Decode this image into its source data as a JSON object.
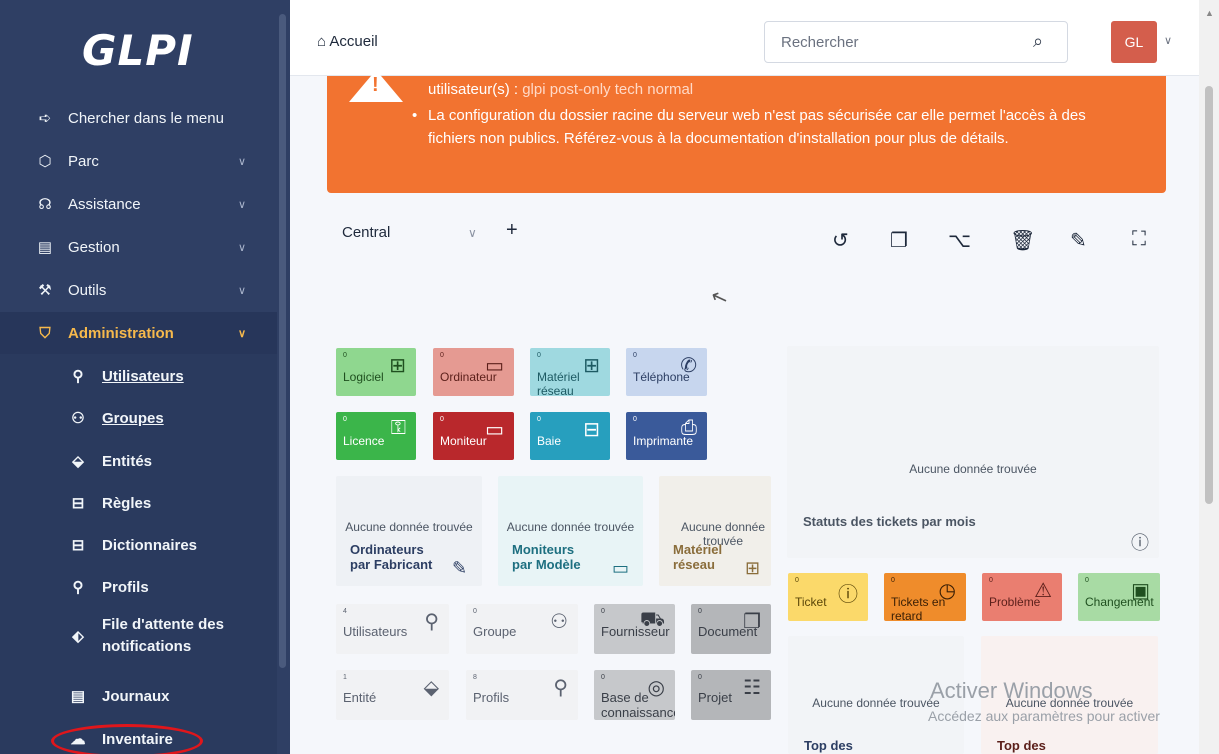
{
  "sidebar": {
    "logo": "GLPI",
    "items": [
      {
        "label": "Chercher dans le menu",
        "icon": "➪"
      },
      {
        "label": "Parc",
        "icon": "⬡"
      },
      {
        "label": "Assistance",
        "icon": "☊"
      },
      {
        "label": "Gestion",
        "icon": "▤"
      },
      {
        "label": "Outils",
        "icon": "⚒"
      },
      {
        "label": "Administration",
        "icon": "⛉"
      }
    ],
    "sub_items": [
      {
        "label": "Utilisateurs",
        "icon": "⚲"
      },
      {
        "label": "Groupes",
        "icon": "⚇"
      },
      {
        "label": "Entités",
        "icon": "⬙"
      },
      {
        "label": "Règles",
        "icon": "⊟"
      },
      {
        "label": "Dictionnaires",
        "icon": "⊟"
      },
      {
        "label": "Profils",
        "icon": "⚲"
      },
      {
        "label": "File d'attente des",
        "label2": "notifications",
        "icon": "⬖"
      },
      {
        "label": "Journaux",
        "icon": "▤"
      },
      {
        "label": "Inventaire",
        "icon": "☁"
      }
    ]
  },
  "header": {
    "home_label": "Accueil",
    "search_placeholder": "Rechercher",
    "avatar_initials": "GL"
  },
  "alert": {
    "line1_prefix": "utilisateur(s) : ",
    "line1_users": "glpi post-only tech normal",
    "bullet": "La configuration du dossier racine du serveur web n'est pas sécurisée car elle permet l'accès à des fichiers non publics. Référez-vous à la documentation d'installation pour plus de détails."
  },
  "dashboard": {
    "selected": "Central",
    "add": "+",
    "tools": [
      "history-icon",
      "copy-icon",
      "share-icon",
      "trash-icon",
      "edit-icon",
      "fullscreen-icon"
    ],
    "small_cards": [
      {
        "num": "0",
        "label": "Logiciel",
        "icon": "⊞"
      },
      {
        "num": "0",
        "label": "Ordinateur",
        "icon": "▭"
      },
      {
        "num": "0",
        "label": "Matériel réseau",
        "icon": "⊞"
      },
      {
        "num": "0",
        "label": "Téléphone",
        "icon": "✆"
      },
      {
        "num": "0",
        "label": "Licence",
        "icon": "⚿"
      },
      {
        "num": "0",
        "label": "Moniteur",
        "icon": "▭"
      },
      {
        "num": "0",
        "label": "Baie",
        "icon": "⊟"
      },
      {
        "num": "0",
        "label": "Imprimante",
        "icon": "⎙"
      }
    ],
    "mid_cards": [
      {
        "none": "Aucune donnée trouvée",
        "title": "Ordinateurs par Fabricant",
        "icon": "✎"
      },
      {
        "none": "Aucune donnée trouvée",
        "title": "Moniteurs par Modèle",
        "icon": "▭"
      },
      {
        "none": "Aucune donnée trouvée",
        "title": "Matériel réseau",
        "icon": "⊞"
      }
    ],
    "status_card": {
      "none": "Aucune donnée trouvée",
      "title": "Statuts des tickets par mois",
      "icon": "ⓘ"
    },
    "ticket_cards": [
      {
        "num": "0",
        "label": "Ticket",
        "icon": "ⓘ"
      },
      {
        "num": "0",
        "label": "Tickets en retard",
        "icon": "◷"
      },
      {
        "num": "0",
        "label": "Problème",
        "icon": "⚠"
      },
      {
        "num": "0",
        "label": "Changement",
        "icon": "▣"
      }
    ],
    "gray_cards": [
      {
        "num": "4",
        "label": "Utilisateurs",
        "icon": "⚲"
      },
      {
        "num": "0",
        "label": "Groupe",
        "icon": "⚇"
      },
      {
        "num": "0",
        "label": "Fournisseur",
        "icon": "⛟"
      },
      {
        "num": "0",
        "label": "Document",
        "icon": "❐"
      },
      {
        "num": "1",
        "label": "Entité",
        "icon": "⬙"
      },
      {
        "num": "8",
        "label": "Profils",
        "icon": "⚲"
      },
      {
        "num": "0",
        "label": "Base de connaissances",
        "icon": "◎"
      },
      {
        "num": "0",
        "label": "Projet",
        "icon": "☷"
      }
    ],
    "bottom_cards": [
      {
        "none": "Aucune donnée trouvée",
        "title": "Top des"
      },
      {
        "none": "Aucune donnée trouvée",
        "title": "Top des"
      }
    ]
  },
  "watermark": {
    "line1": "Activer Windows",
    "line2": "Accédez aux paramètres pour activer"
  }
}
